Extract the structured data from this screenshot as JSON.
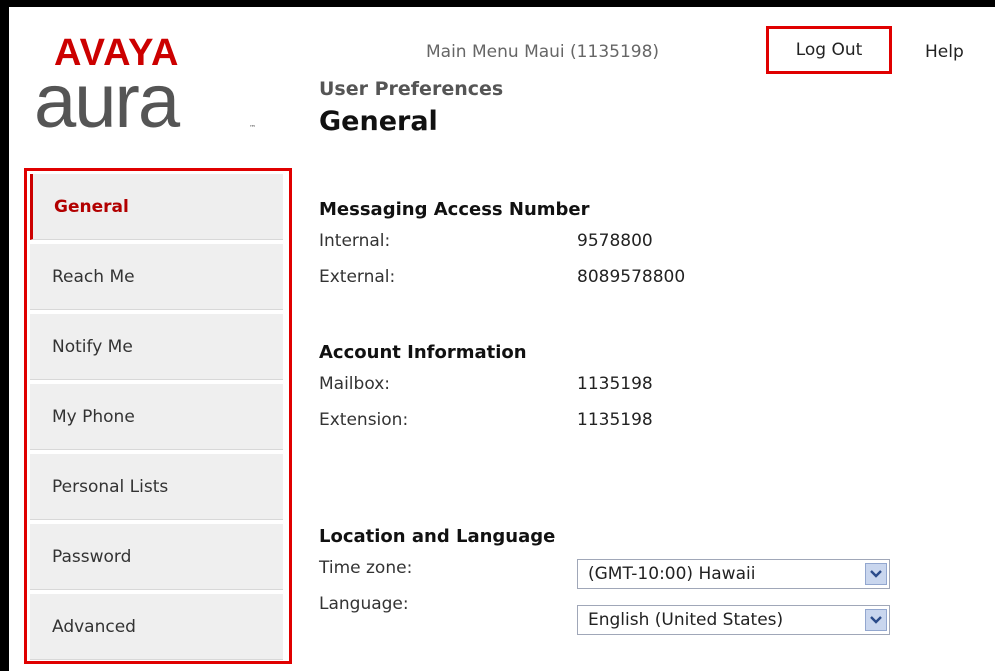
{
  "brand": {
    "avaya": "AVAYA",
    "aura": "aura",
    "trademark": "™"
  },
  "topnav": {
    "main_menu": "Main Menu Maui (1135198)",
    "logout": "Log Out",
    "help": "Help"
  },
  "heading": {
    "breadcrumb": "User Preferences",
    "title": "General"
  },
  "sidebar": {
    "items": [
      {
        "label": "General",
        "active": true
      },
      {
        "label": "Reach Me"
      },
      {
        "label": "Notify Me"
      },
      {
        "label": "My Phone"
      },
      {
        "label": "Personal Lists"
      },
      {
        "label": "Password"
      },
      {
        "label": "Advanced"
      }
    ]
  },
  "messaging": {
    "title": "Messaging Access Number",
    "internal_label": "Internal:",
    "internal_value": "9578800",
    "external_label": "External:",
    "external_value": "8089578800"
  },
  "account": {
    "title": "Account Information",
    "mailbox_label": "Mailbox:",
    "mailbox_value": "1135198",
    "extension_label": "Extension:",
    "extension_value": "1135198"
  },
  "location": {
    "title": "Location and Language",
    "timezone_label": "Time zone:",
    "timezone_value": "(GMT-10:00) Hawaii",
    "language_label": "Language:",
    "language_value": "English (United States)"
  },
  "colors": {
    "accent": "#cc0000",
    "highlight_border": "#e00000",
    "sidebar_bg": "#efefef",
    "dropdown_arrow_bg": "#c9d6ee"
  }
}
